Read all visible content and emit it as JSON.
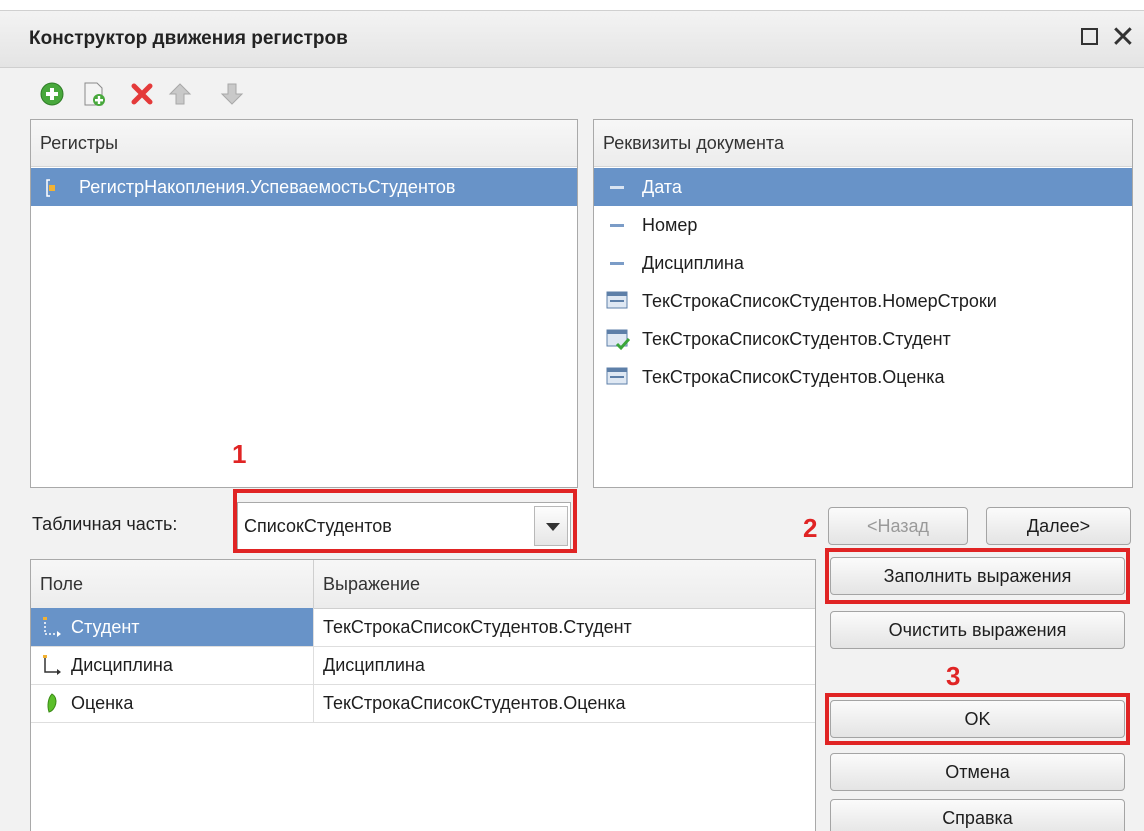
{
  "window": {
    "title": "Конструктор движения регистров"
  },
  "toolbar": {
    "buttons": [
      "add-icon",
      "copy-icon",
      "delete-icon",
      "move-up-icon",
      "move-down-icon"
    ]
  },
  "registers": {
    "header": "Регистры",
    "items": [
      {
        "label": "РегистрНакопления.УспеваемостьСтудентов",
        "selected": true
      }
    ]
  },
  "attributes": {
    "header": "Реквизиты документа",
    "items": [
      {
        "label": "Дата",
        "icon": "attribute-icon",
        "selected": true
      },
      {
        "label": "Номер",
        "icon": "attribute-icon"
      },
      {
        "label": "Дисциплина",
        "icon": "attribute-icon"
      },
      {
        "label": "ТекСтрокаСписокСтудентов.НомерСтроки",
        "icon": "tabular-attribute-icon"
      },
      {
        "label": "ТекСтрокаСписокСтудентов.Студент",
        "icon": "tabular-attribute-checked-icon"
      },
      {
        "label": "ТекСтрокаСписокСтудентов.Оценка",
        "icon": "tabular-attribute-icon"
      }
    ]
  },
  "tabular": {
    "label": "Табличная часть:",
    "value": "СписокСтудентов"
  },
  "annotations": {
    "marker1": "1",
    "marker2": "2",
    "marker3": "3",
    "color": "#e02424"
  },
  "nav": {
    "back": "<Назад",
    "next": "Далее>"
  },
  "actions": {
    "fill": "Заполнить выражения",
    "clear": "Очистить выражения",
    "ok": "OK",
    "cancel": "Отмена",
    "help": "Справка"
  },
  "grid": {
    "col_field": "Поле",
    "col_expr": "Выражение",
    "rows": [
      {
        "field": "Студент",
        "expr": "ТекСтрокаСписокСтудентов.Студент",
        "icon": "dimension-icon",
        "selected": true
      },
      {
        "field": "Дисциплина",
        "expr": "Дисциплина",
        "icon": "dimension-icon"
      },
      {
        "field": "Оценка",
        "expr": "ТекСтрокаСписокСтудентов.Оценка",
        "icon": "resource-icon"
      }
    ]
  },
  "colors": {
    "selection": "#6893c8",
    "accent_red": "#e02424"
  }
}
